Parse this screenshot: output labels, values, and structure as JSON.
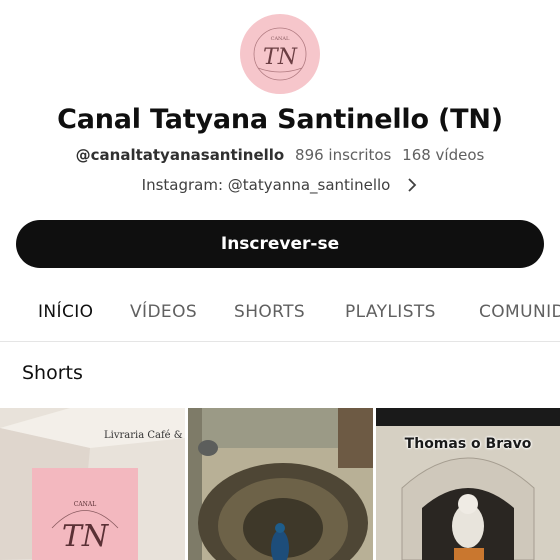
{
  "channel": {
    "logo_text": "TN",
    "logo_caption": "CANAL",
    "name": "Canal Tatyana Santinello (TN)",
    "handle": "@canaltatyanasantinello",
    "subscribers": "896 inscritos",
    "videos": "168 vídeos",
    "link": "Instagram: @tatyanna_santinello",
    "subscribe_label": "Inscrever-se"
  },
  "tabs": [
    {
      "label": "INÍCIO",
      "active": true
    },
    {
      "label": "VÍDEOS",
      "active": false
    },
    {
      "label": "SHORTS",
      "active": false
    },
    {
      "label": "PLAYLISTS",
      "active": false
    },
    {
      "label": "COMUNIDADE",
      "active": false
    }
  ],
  "shorts": {
    "section_title": "Shorts",
    "items": [
      {
        "overlay_text": "Livraria Café & Poe"
      },
      {
        "overlay_text": ""
      },
      {
        "overlay_text": "Thomas o Bravo"
      }
    ]
  },
  "colors": {
    "avatar_bg": "#f6c6cb",
    "subscribe_bg": "#0f0f0f",
    "accent_text": "#0f0f0f",
    "muted_text": "#606060"
  }
}
